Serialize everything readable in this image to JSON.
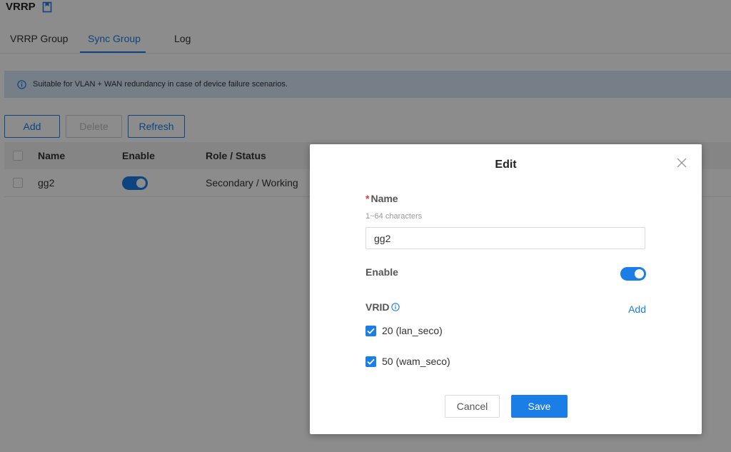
{
  "page": {
    "title": "VRRP",
    "title_icon": "bookmark-icon"
  },
  "tabs": [
    {
      "label": "VRRP Group",
      "active": false
    },
    {
      "label": "Sync Group",
      "active": true
    },
    {
      "label": "Log",
      "active": false
    }
  ],
  "banner": {
    "text": "Suitable for VLAN + WAN redundancy in case of device failure scenarios.",
    "icon": "info-icon"
  },
  "toolbar": {
    "add_label": "Add",
    "delete_label": "Delete",
    "refresh_label": "Refresh"
  },
  "table": {
    "headers": {
      "name": "Name",
      "enable": "Enable",
      "role_status": "Role / Status"
    },
    "rows": [
      {
        "name": "gg2",
        "enabled": true,
        "role_status": "Secondary / Working"
      }
    ]
  },
  "modal": {
    "title": "Edit",
    "name_label": "Name",
    "name_hint": "1~64 characters",
    "name_value": "gg2",
    "enable_label": "Enable",
    "enable_value": true,
    "vrid_label": "VRID",
    "vrid_add_label": "Add",
    "vrid_items": [
      {
        "label": "20 (lan_seco)",
        "checked": true
      },
      {
        "label": "50 (wam_seco)",
        "checked": true
      }
    ],
    "cancel_label": "Cancel",
    "save_label": "Save"
  },
  "colors": {
    "accent": "#1a7ee6",
    "banner_bg": "#d7e6f7",
    "required": "#e0373d"
  }
}
